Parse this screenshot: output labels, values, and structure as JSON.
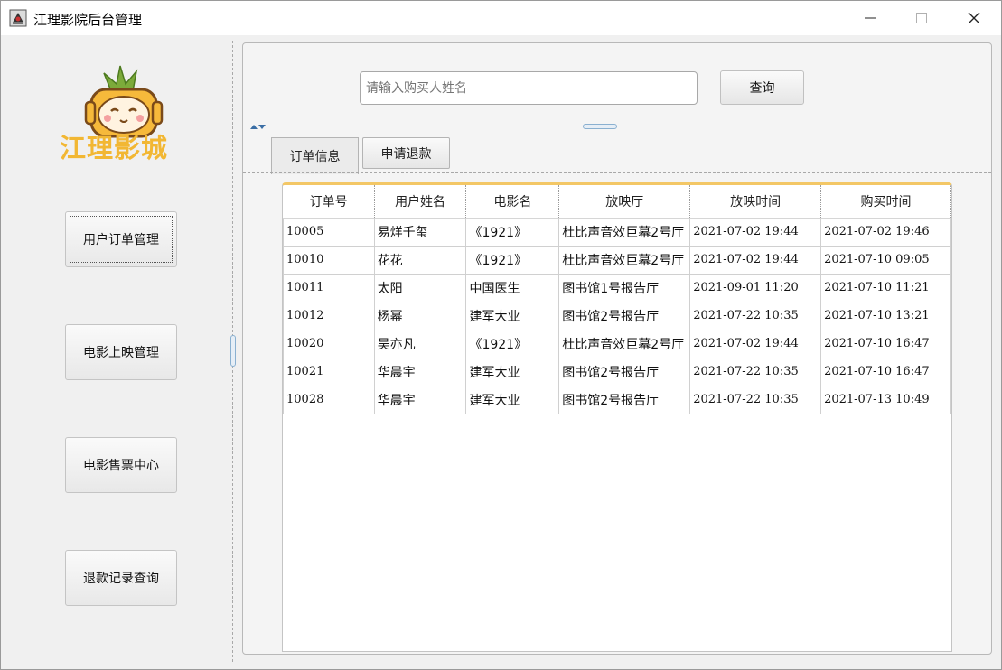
{
  "window": {
    "title": "江理影院后台管理",
    "icon": "app-icon",
    "controls": [
      "minimize-icon",
      "maximize-icon",
      "close-icon"
    ]
  },
  "sidebar": {
    "logo_text": "江理影城",
    "items": [
      {
        "label": "用户订单管理",
        "focused": true
      },
      {
        "label": "电影上映管理"
      },
      {
        "label": "电影售票中心"
      },
      {
        "label": "退款记录查询"
      }
    ]
  },
  "search": {
    "placeholder": "请输入购买人姓名",
    "button_label": "查询"
  },
  "tabs": [
    {
      "label": "订单信息",
      "active": true
    },
    {
      "label": "申请退款",
      "active": false
    }
  ],
  "table": {
    "columns": [
      "订单号",
      "用户姓名",
      "电影名",
      "放映厅",
      "放映时间",
      "购买时间"
    ],
    "rows": [
      [
        "10005",
        "易烊千玺",
        "《1921》",
        "杜比声音效巨幕2号厅",
        "2021-07-02 19:44",
        "2021-07-02 19:46"
      ],
      [
        "10010",
        "花花",
        "《1921》",
        "杜比声音效巨幕2号厅",
        "2021-07-02 19:44",
        "2021-07-10 09:05"
      ],
      [
        "10011",
        "太阳",
        "中国医生",
        "图书馆1号报告厅",
        "2021-09-01 11:20",
        "2021-07-10 11:21"
      ],
      [
        "10012",
        "杨幂",
        "建军大业",
        "图书馆2号报告厅",
        "2021-07-22 10:35",
        "2021-07-10 13:21"
      ],
      [
        "10020",
        "吴亦凡",
        "《1921》",
        "杜比声音效巨幕2号厅",
        "2021-07-02 19:44",
        "2021-07-10 16:47"
      ],
      [
        "10021",
        "华晨宇",
        "建军大业",
        "图书馆2号报告厅",
        "2021-07-22 10:35",
        "2021-07-10 16:47"
      ],
      [
        "10028",
        "华晨宇",
        "建军大业",
        "图书馆2号报告厅",
        "2021-07-22 10:35",
        "2021-07-13 10:49"
      ]
    ]
  },
  "colors": {
    "accent": "#f3c766",
    "logo": "#f2b733",
    "window_bg": "#f0f0f0"
  }
}
